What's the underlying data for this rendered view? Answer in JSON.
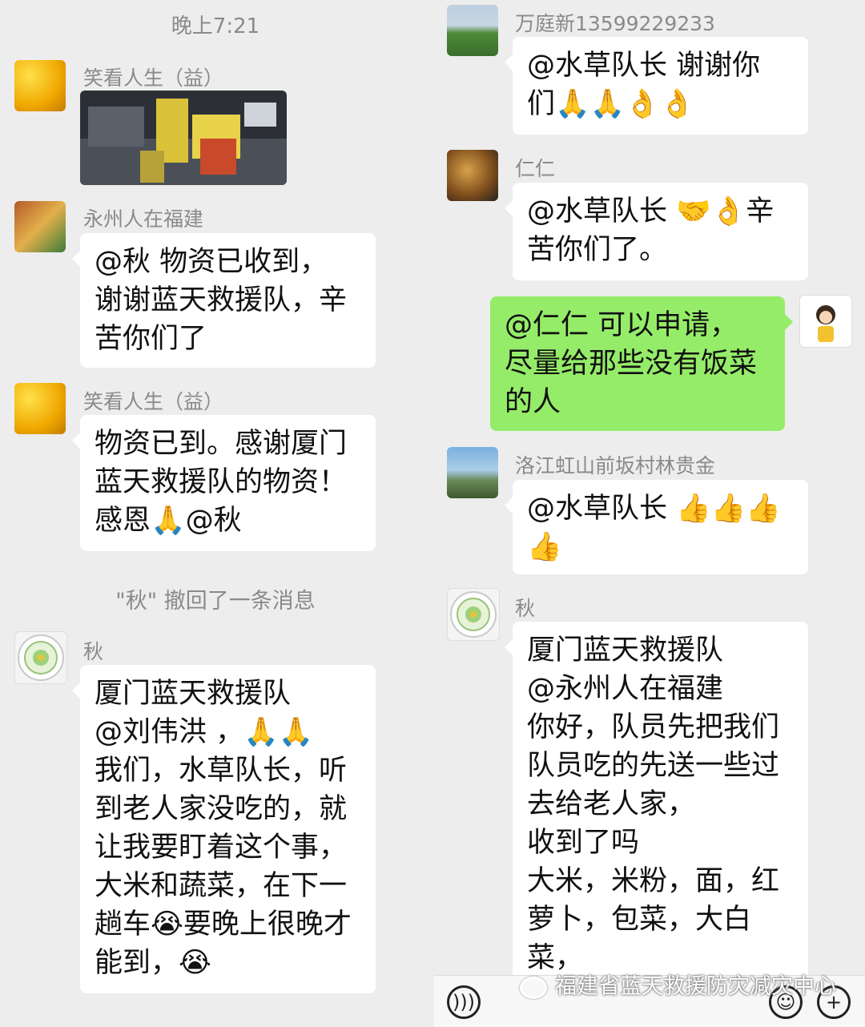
{
  "panel1": {
    "timestamp": "晚上7:21",
    "msg1": {
      "sender": "笑看人生（益）"
    },
    "msg2": {
      "sender": "永州人在福建",
      "text": "@秋  物资已收到，\n谢谢蓝天救援队，辛\n苦你们了"
    },
    "msg3": {
      "sender": "笑看人生（益）",
      "text": "物资已到。感谢厦门\n蓝天救援队的物资！\n感恩🙏@秋"
    }
  },
  "panel2": {
    "system_notice": "\"秋\" 撤回了一条消息",
    "msg1": {
      "sender": "秋",
      "text": "厦门蓝天救援队\n@刘伟洪 ，🙏🙏\n我们，水草队长，听\n到老人家没吃的，就\n让我要盯着这个事，\n大米和蔬菜，在下一\n趟车😭要晚上很晚才\n能到，😭"
    }
  },
  "panel3": {
    "msg1": {
      "sender": "万庭新13599229233",
      "text": "@水草队长  谢谢你\n们🙏🙏👌👌"
    },
    "msg2": {
      "sender": "仁仁",
      "text": "@水草队长 🤝👌辛\n苦你们了。"
    },
    "msg3": {
      "text": "@仁仁  可以申请，\n尽量给那些没有饭菜\n的人"
    },
    "msg4": {
      "sender": "洛江虹山前坂村林贵金",
      "text": "@水草队长 👍👍👍\n👍"
    }
  },
  "panel4": {
    "msg1": {
      "sender": "秋",
      "text": "厦门蓝天救援队\n@永州人在福建\n你好，队员先把我们\n队员吃的先送一些过\n去给老人家，\n收到了吗\n大米，米粉，面，红\n萝卜，包菜，大白菜，\n土豆，"
    },
    "watermark": "福建省蓝天救援防灾减灾中心"
  },
  "icons": {
    "voice": "voice-icon",
    "emoji": "emoji-icon",
    "plus": "plus-icon",
    "wechat": "wechat-logo-icon"
  }
}
